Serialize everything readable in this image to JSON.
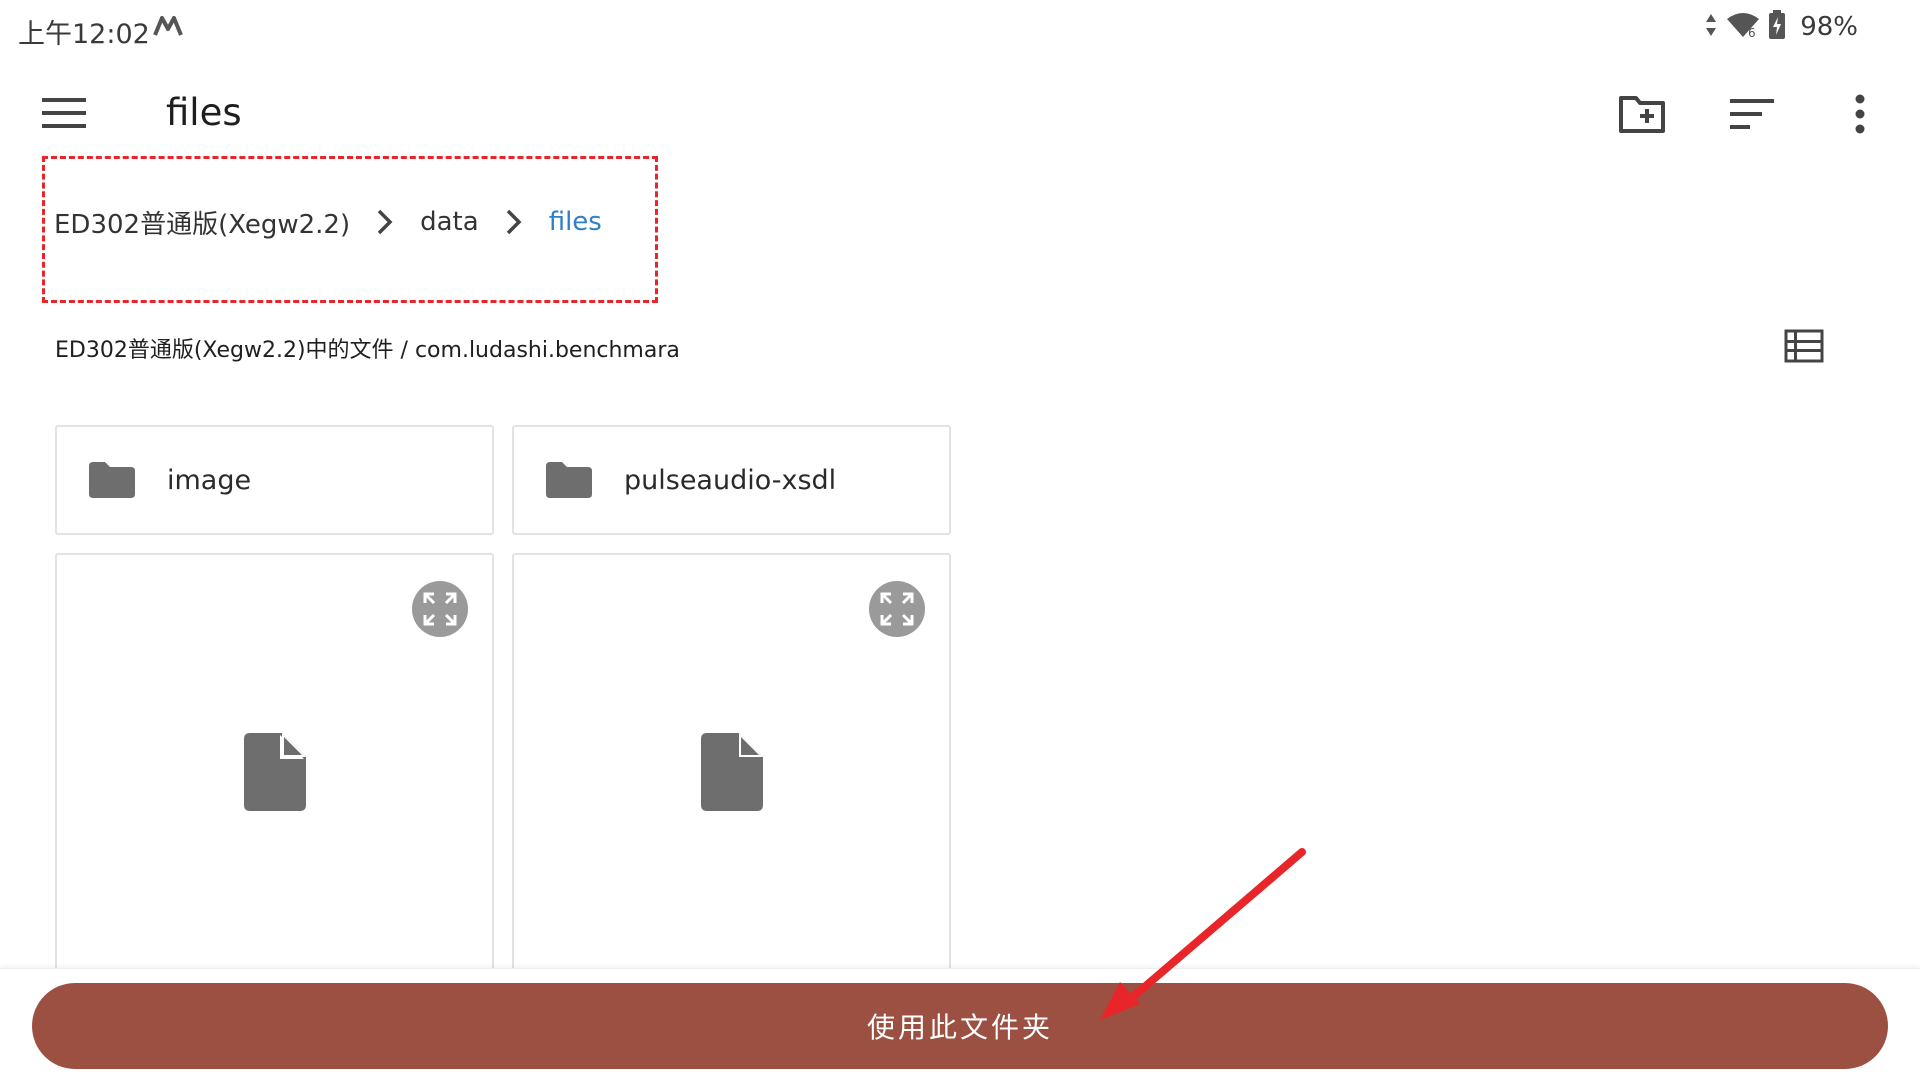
{
  "status_bar": {
    "time": "上午12:02",
    "battery": "98%",
    "icons": [
      "data-arrows-icon",
      "wifi-icon",
      "battery-charging-icon"
    ]
  },
  "app_bar": {
    "title": "files",
    "actions": [
      "new-folder-icon",
      "sort-icon",
      "more-vert-icon"
    ]
  },
  "breadcrumb": {
    "items": [
      {
        "label": "ED302普通版(Xegw2.2)"
      },
      {
        "label": "data"
      },
      {
        "label": "files"
      }
    ]
  },
  "path_line": "ED302普通版(Xegw2.2)中的文件 / com.ludashi.benchmara",
  "folders": [
    {
      "name": "image"
    },
    {
      "name": "pulseaudio-xsdl"
    }
  ],
  "files": [
    {
      "icon": "file-icon"
    },
    {
      "icon": "file-icon"
    }
  ],
  "bottom": {
    "use_folder_label": "使用此文件夹"
  },
  "colors": {
    "accent_link": "#2f7fc8",
    "button_bg": "#9b5042",
    "annotation_red": "#e8262a"
  }
}
